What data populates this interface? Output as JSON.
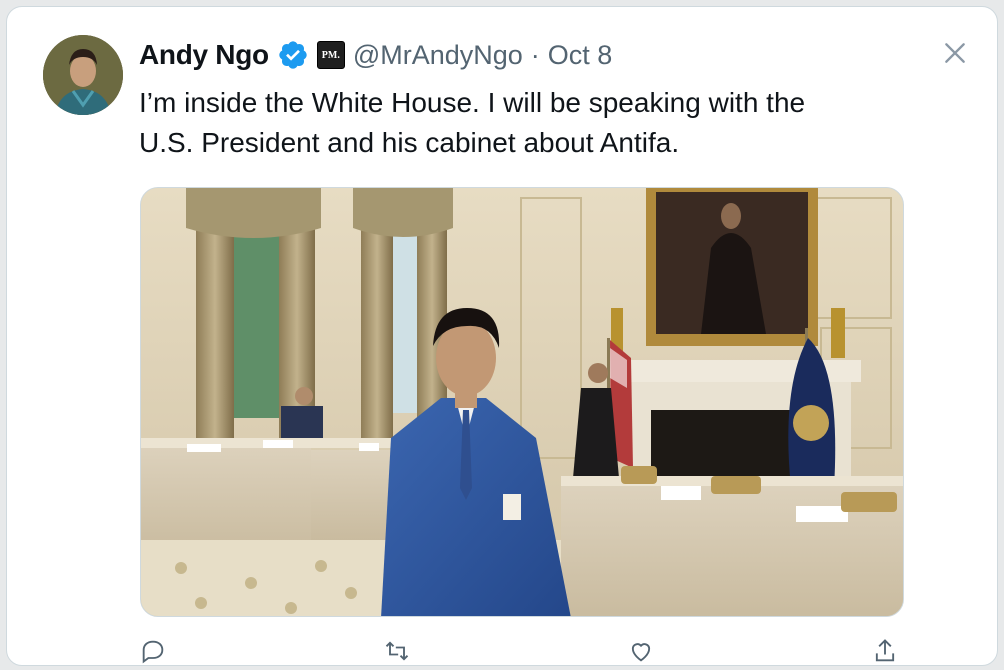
{
  "tweet": {
    "author_name": "Andy Ngo",
    "affiliate_badge": "PM.",
    "handle": "@MrAndyNgo",
    "separator": "·",
    "date": "Oct 8",
    "text_lines": [
      "I’m inside the White House. I will be speaking with the",
      "U.S. President and his cabinet about Antifa."
    ]
  },
  "icons": {
    "verified": "verified-badge-icon",
    "close": "close-icon",
    "actions": [
      "reply-icon",
      "repost-icon",
      "like-icon",
      "share-icon"
    ]
  },
  "colors": {
    "verified": "#1d9bf0",
    "text": "#0f1419",
    "secondary": "#536471",
    "border": "#cfd9de"
  }
}
